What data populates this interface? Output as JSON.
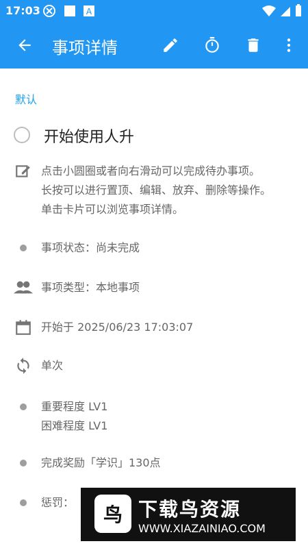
{
  "status_bar": {
    "time": "17:03",
    "icons": [
      "notification-icon",
      "square-icon",
      "a-icon",
      "wifi-icon",
      "signal-icon",
      "battery-icon"
    ]
  },
  "app_bar": {
    "title": "事项详情",
    "actions": [
      "back-arrow-icon",
      "edit-icon",
      "timer-icon",
      "trash-icon",
      "more-vertical-icon"
    ]
  },
  "detail": {
    "section": "默认",
    "task_title": "开始使用人升",
    "description_lines": [
      "点击小圆圈或者向右滑动可以完成待办事项。",
      "长按可以进行置顶、编辑、放弃、删除等操作。",
      "单击卡片可以浏览事项详情。"
    ],
    "status": "事项状态：尚未完成",
    "type": "事项类型：本地事项",
    "start": "开始于 2025/06/23 17:03:07",
    "repeat": "单次",
    "importance": "重要程度 LV1",
    "difficulty": "困难程度 LV1",
    "reward": "完成奖励「学识」130点",
    "penalty": "惩罚："
  },
  "watermark": {
    "logo_text": "鸟",
    "title": "下载鸟资源",
    "url": "WWW.XIAZAINIAO.COM"
  },
  "colors": {
    "primary": "#2196F3",
    "section": "#1DA1F2",
    "text_secondary": "#666666"
  }
}
